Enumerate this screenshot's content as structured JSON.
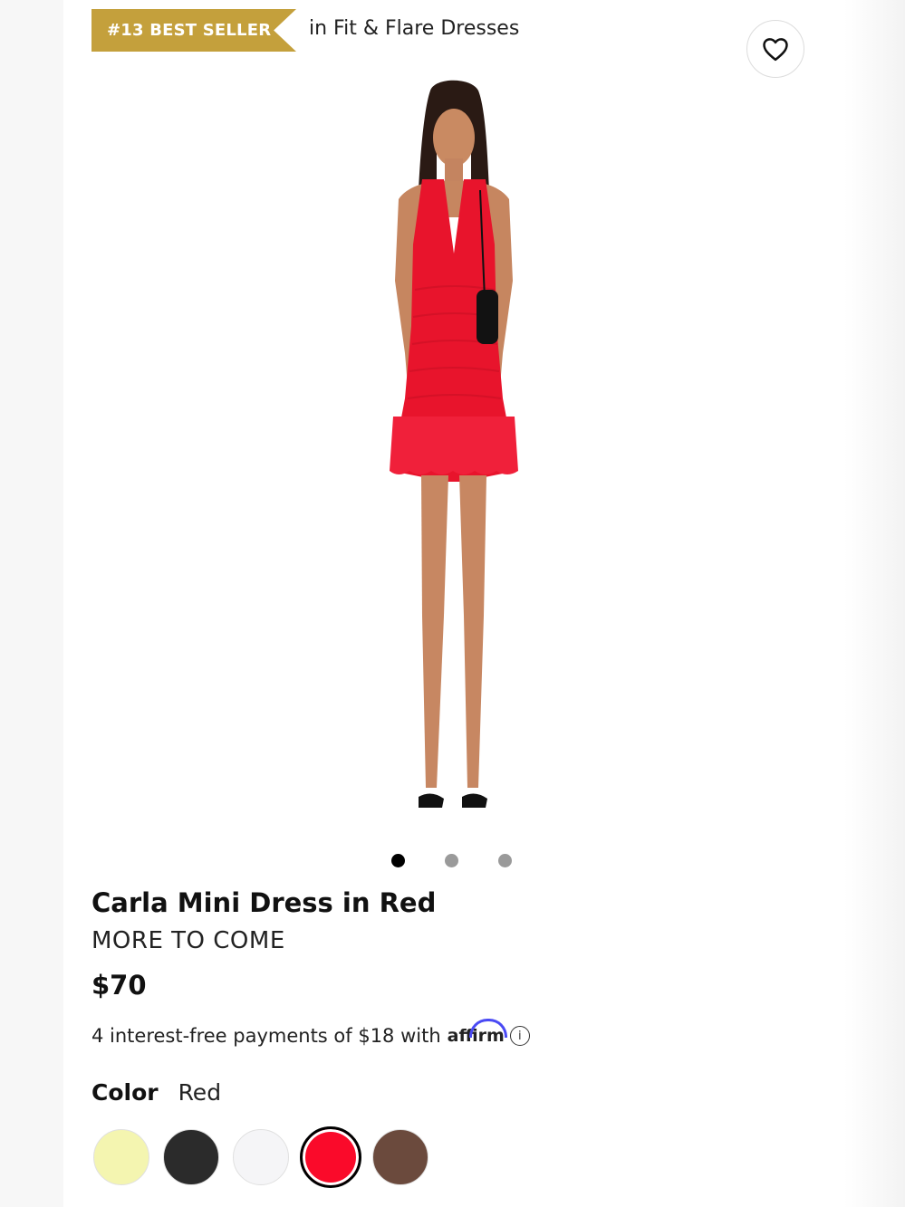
{
  "badge": {
    "rank_label": "#13 BEST SELLER",
    "category_text": "in Fit & Flare Dresses"
  },
  "wishlist": {
    "icon": "heart-icon"
  },
  "gallery": {
    "image_alt": "Model wearing red halter mini dress with ruffle hem",
    "total_images": 3,
    "active_index": 1
  },
  "product": {
    "title": "Carla Mini Dress in Red",
    "brand": "MORE TO COME",
    "price": "$70"
  },
  "payments": {
    "text": "4 interest-free payments of $18 with",
    "provider": "affirm",
    "info_icon": "info-icon"
  },
  "color": {
    "label": "Color",
    "selected": "Red",
    "swatches": [
      {
        "name": "Yellow",
        "hex": "#f4f5b0"
      },
      {
        "name": "Black",
        "hex": "#2b2b2b"
      },
      {
        "name": "White",
        "hex": "#f5f5f7"
      },
      {
        "name": "Red",
        "hex": "#fa0a2a"
      },
      {
        "name": "Brown",
        "hex": "#6b4a3d"
      }
    ]
  },
  "colors": {
    "badge_gold": "#c4a03c",
    "affirm_blue": "#4a4af4"
  }
}
